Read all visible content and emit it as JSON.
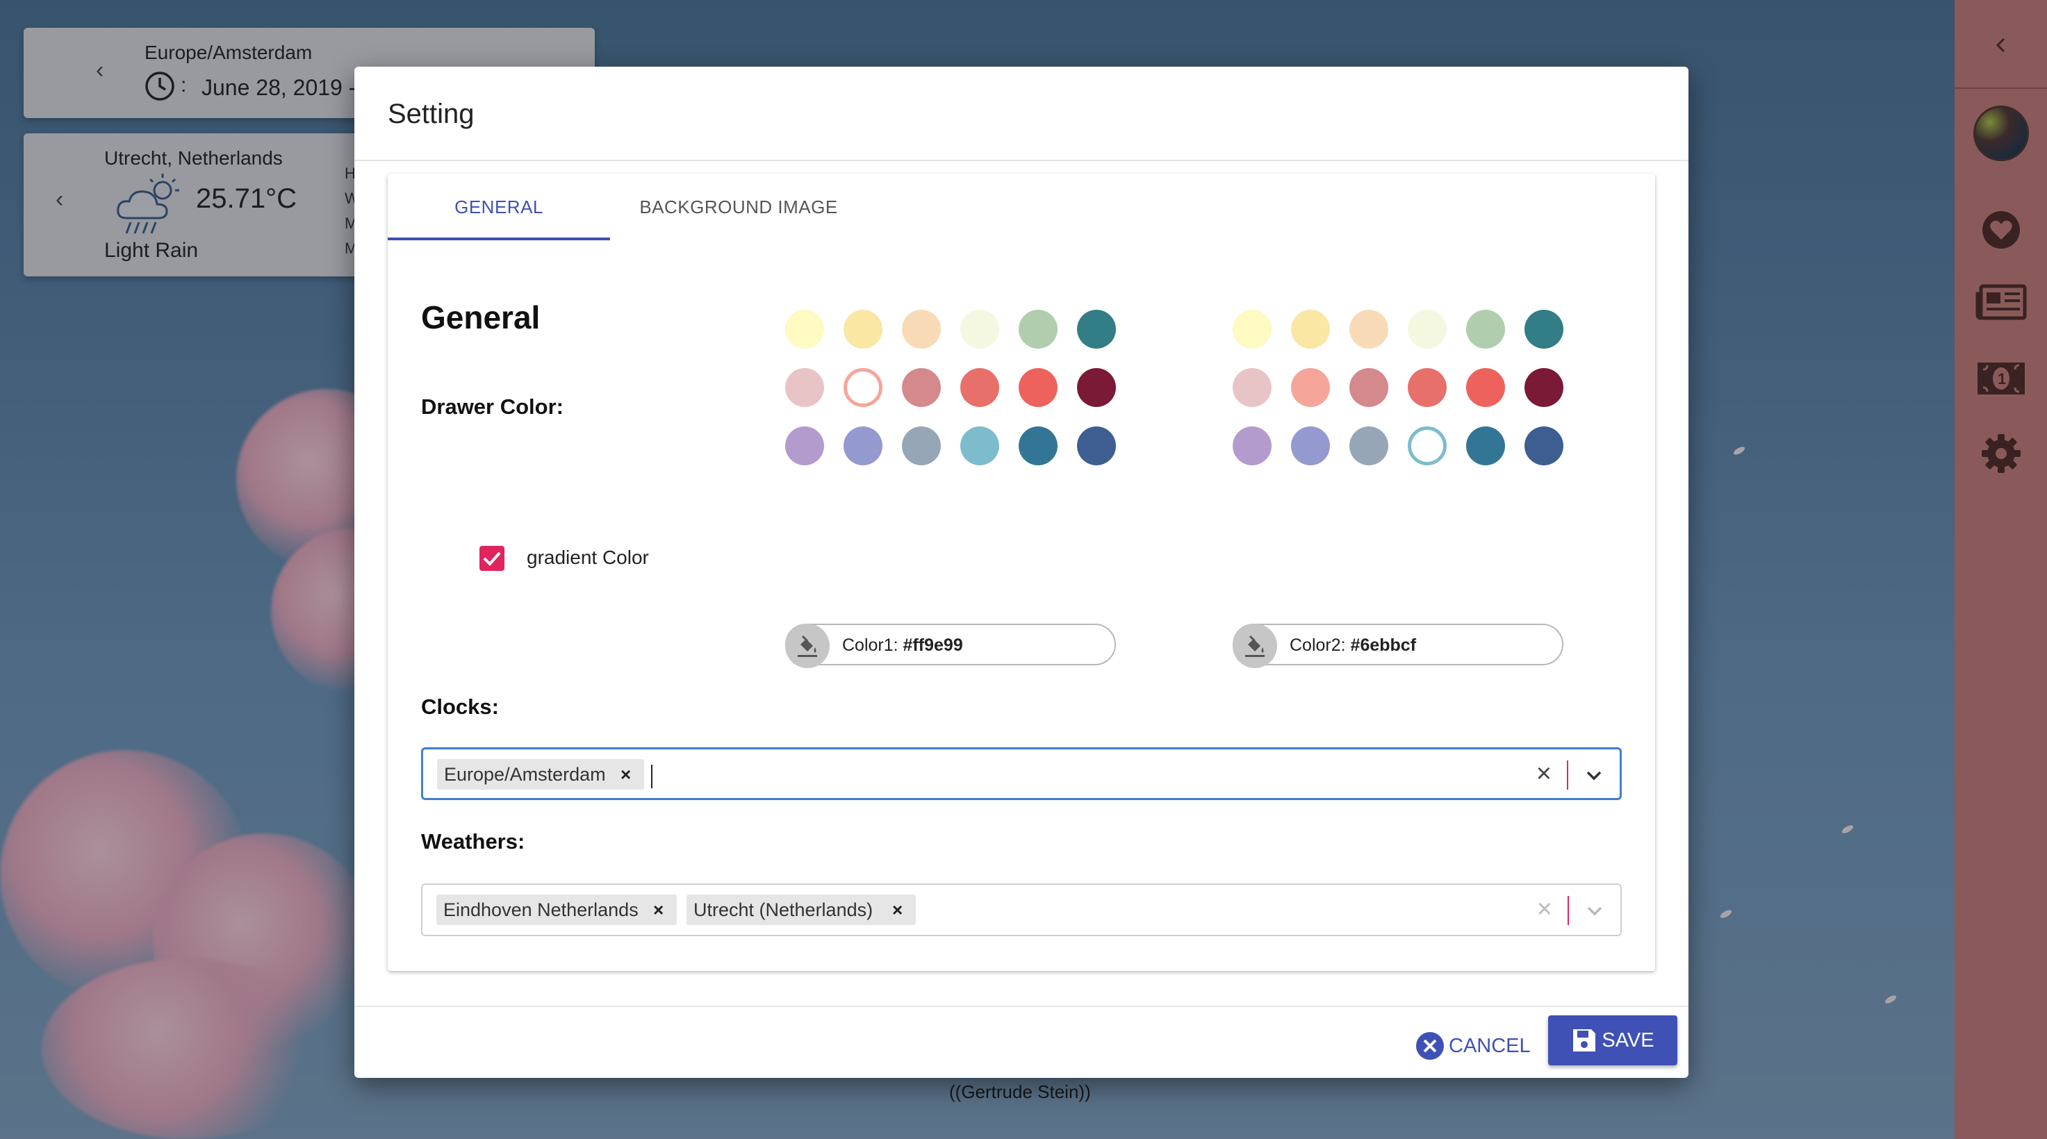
{
  "background": {
    "quote": "((Gertrude Stein))"
  },
  "clock_widget": {
    "timezone": "Europe/Amsterdam",
    "date": "June 28, 2019 -"
  },
  "weather_widget": {
    "location": "Utrecht, Netherlands",
    "temperature": "25.71°C",
    "condition": "Light Rain",
    "partial_letters": [
      "H",
      "W",
      "M",
      "M"
    ]
  },
  "sidebar": {
    "items": [
      {
        "icon": "chevron-left-icon"
      },
      {
        "icon": "avatar"
      },
      {
        "icon": "heart-icon"
      },
      {
        "icon": "newspaper-icon"
      },
      {
        "icon": "money-icon"
      },
      {
        "icon": "gear-icon"
      }
    ]
  },
  "dialog": {
    "title": "Setting",
    "tabs": [
      {
        "label": "GENERAL",
        "active": true
      },
      {
        "label": "BACKGROUND IMAGE",
        "active": false
      }
    ],
    "section_title": "General",
    "drawer_color_label": "Drawer Color:",
    "gradient_checkbox": {
      "label": "gradient Color",
      "checked": true
    },
    "palette1": {
      "colors": [
        "#fff9c2",
        "#fbe7a4",
        "#f8dbb6",
        "#f4f8e0",
        "#b0ceae",
        "#327d86",
        "#e8c4c7",
        "#f5a59a",
        "#d4898d",
        "#e8706a",
        "#ee625d",
        "#7a1a37",
        "#b39ccd",
        "#9499cf",
        "#96a6b7",
        "#7cbccd",
        "#337595",
        "#3e5e91"
      ],
      "selected": "#f5a59a",
      "field_label": "Color1: ",
      "field_value": "#ff9e99"
    },
    "palette2": {
      "colors": [
        "#fff9c2",
        "#fbe7a4",
        "#f8dbb6",
        "#f4f8e0",
        "#b0ceae",
        "#327d86",
        "#e8c4c7",
        "#f5a59a",
        "#d4898d",
        "#e8706a",
        "#ee625d",
        "#7a1a37",
        "#b39ccd",
        "#9499cf",
        "#96a6b7",
        "#7cbccd",
        "#337595",
        "#3e5e91"
      ],
      "selected": "#7cbccd",
      "field_label": "Color2: ",
      "field_value": "#6ebbcf"
    },
    "clocks": {
      "label": "Clocks:",
      "chips": [
        "Europe/Amsterdam"
      ]
    },
    "weathers": {
      "label": "Weathers:",
      "chips": [
        "Eindhoven Netherlands",
        "Utrecht (Netherlands)"
      ]
    },
    "buttons": {
      "cancel": "CANCEL",
      "save": "SAVE"
    }
  },
  "colors": {
    "accent": "#3f51b5",
    "checkbox": "#e0245e",
    "sidebar": "#8a5a5a"
  }
}
